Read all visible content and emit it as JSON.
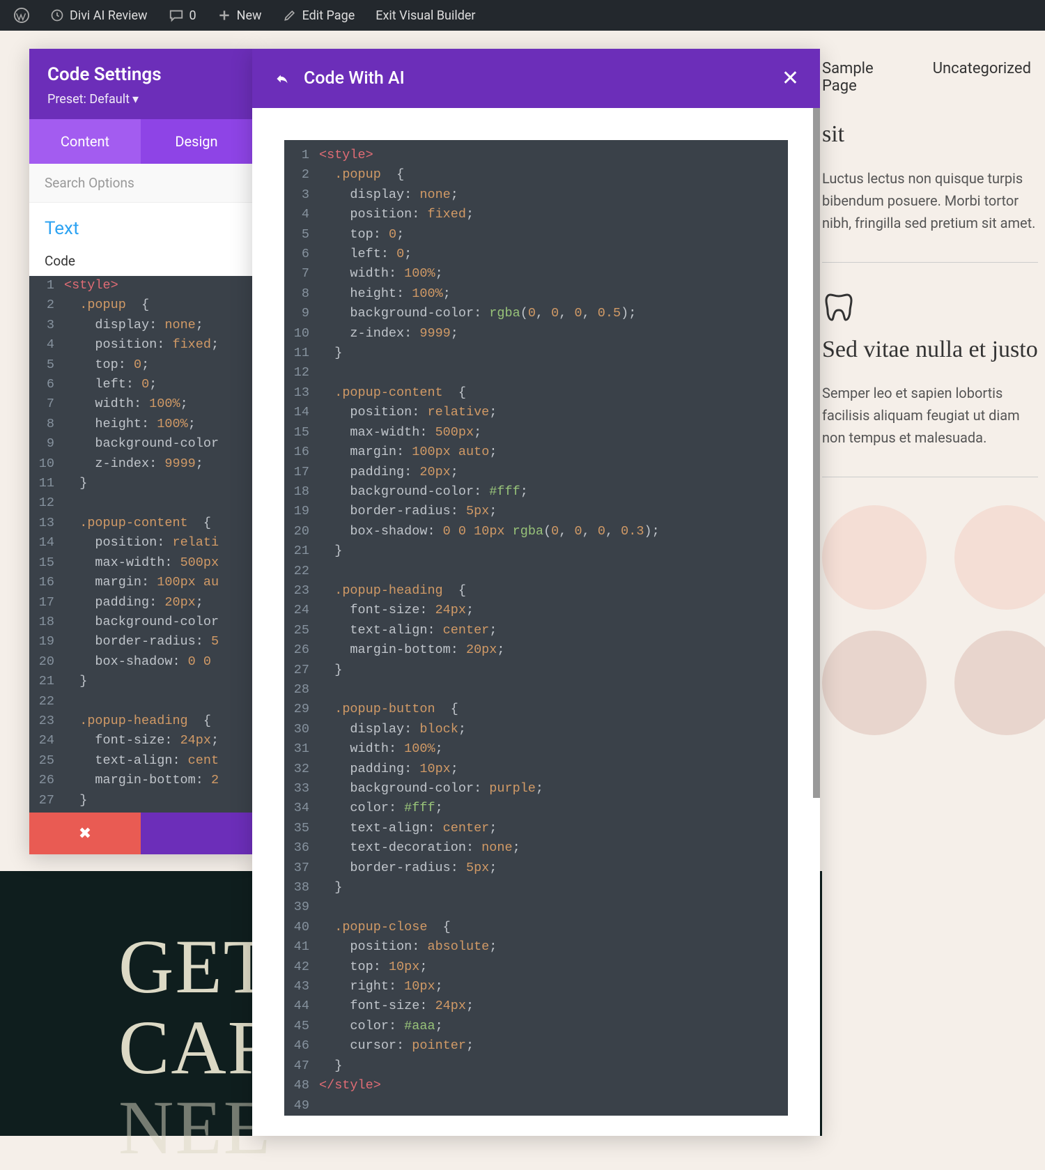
{
  "adminbar": {
    "site_title": "Divi AI Review",
    "comments_count": "0",
    "new_label": "New",
    "edit_page": "Edit Page",
    "exit_vb": "Exit Visual Builder"
  },
  "topnav": {
    "sample": "Sample Page",
    "uncat": "Uncategorized"
  },
  "rightcol": {
    "block1_trail": "sit",
    "block1_text": "Luctus lectus non quisque turpis bibendum posuere. Morbi tortor nibh, fringilla sed pretium sit amet.",
    "block2_heading": "Sed vitae nulla et justo",
    "block2_text": "Semper leo et sapien lobortis facilisis aliquam feugiat ut diam non tempus et malesuada."
  },
  "hero": {
    "line1": "GET",
    "line2": "CAR",
    "line3": "NEE"
  },
  "settings": {
    "title": "Code Settings",
    "preset": "Preset: Default",
    "tabs": {
      "content": "Content",
      "design": "Design"
    },
    "search_placeholder": "Search Options",
    "section_text": "Text",
    "field_code": "Code"
  },
  "ai": {
    "title": "Code With AI"
  },
  "code_lines_small": [
    {
      "n": "1",
      "html": "<span class='tag'>&lt;style&gt;</span>"
    },
    {
      "n": "2",
      "html": "  <span class='sel'>.popup</span>  <span class='punct'>{</span>"
    },
    {
      "n": "3",
      "html": "    <span class='prop'>display</span><span class='punct'>:</span> <span class='none'>none</span><span class='punct'>;</span>"
    },
    {
      "n": "4",
      "html": "    <span class='prop'>position</span><span class='punct'>:</span> <span class='none'>fixed</span><span class='punct'>;</span>"
    },
    {
      "n": "5",
      "html": "    <span class='prop'>top</span><span class='punct'>:</span> <span class='num'>0</span><span class='punct'>;</span>"
    },
    {
      "n": "6",
      "html": "    <span class='prop'>left</span><span class='punct'>:</span> <span class='num'>0</span><span class='punct'>;</span>"
    },
    {
      "n": "7",
      "html": "    <span class='prop'>width</span><span class='punct'>:</span> <span class='num'>100%</span><span class='punct'>;</span>"
    },
    {
      "n": "8",
      "html": "    <span class='prop'>height</span><span class='punct'>:</span> <span class='num'>100%</span><span class='punct'>;</span>"
    },
    {
      "n": "9",
      "html": "    <span class='prop'>background-color</span>"
    },
    {
      "n": "10",
      "html": "    <span class='prop'>z-index</span><span class='punct'>:</span> <span class='num'>9999</span><span class='punct'>;</span>"
    },
    {
      "n": "11",
      "html": "  <span class='punct'>}</span>"
    },
    {
      "n": "12",
      "html": ""
    },
    {
      "n": "13",
      "html": "  <span class='sel'>.popup-content</span>  <span class='punct'>{</span>"
    },
    {
      "n": "14",
      "html": "    <span class='prop'>position</span><span class='punct'>:</span> <span class='none'>relati</span>"
    },
    {
      "n": "15",
      "html": "    <span class='prop'>max-width</span><span class='punct'>:</span> <span class='num'>500px</span>"
    },
    {
      "n": "16",
      "html": "    <span class='prop'>margin</span><span class='punct'>:</span> <span class='num'>100px</span> <span class='none'>au</span>"
    },
    {
      "n": "17",
      "html": "    <span class='prop'>padding</span><span class='punct'>:</span> <span class='num'>20px</span><span class='punct'>;</span>"
    },
    {
      "n": "18",
      "html": "    <span class='prop'>background-color</span>"
    },
    {
      "n": "19",
      "html": "    <span class='prop'>border-radius</span><span class='punct'>:</span> <span class='num'>5</span>"
    },
    {
      "n": "20",
      "html": "    <span class='prop'>box-shadow</span><span class='punct'>:</span> <span class='num'>0</span> <span class='num'>0</span>"
    },
    {
      "n": "21",
      "html": "  <span class='punct'>}</span>"
    },
    {
      "n": "22",
      "html": ""
    },
    {
      "n": "23",
      "html": "  <span class='sel'>.popup-heading</span>  <span class='punct'>{</span>"
    },
    {
      "n": "24",
      "html": "    <span class='prop'>font-size</span><span class='punct'>:</span> <span class='num'>24px</span><span class='punct'>;</span>"
    },
    {
      "n": "25",
      "html": "    <span class='prop'>text-align</span><span class='punct'>:</span> <span class='none'>cent</span>"
    },
    {
      "n": "26",
      "html": "    <span class='prop'>margin-bottom</span><span class='punct'>:</span> <span class='num'>2</span>"
    },
    {
      "n": "27",
      "html": "  <span class='punct'>}</span>"
    }
  ],
  "code_lines_ai": [
    {
      "n": "1",
      "html": "<span class='tag'>&lt;style&gt;</span>"
    },
    {
      "n": "2",
      "html": "  <span class='sel'>.popup</span>  <span class='punct'>{</span>"
    },
    {
      "n": "3",
      "html": "    <span class='prop'>display</span><span class='punct'>:</span> <span class='none'>none</span><span class='punct'>;</span>"
    },
    {
      "n": "4",
      "html": "    <span class='prop'>position</span><span class='punct'>:</span> <span class='none'>fixed</span><span class='punct'>;</span>"
    },
    {
      "n": "5",
      "html": "    <span class='prop'>top</span><span class='punct'>:</span> <span class='num'>0</span><span class='punct'>;</span>"
    },
    {
      "n": "6",
      "html": "    <span class='prop'>left</span><span class='punct'>:</span> <span class='num'>0</span><span class='punct'>;</span>"
    },
    {
      "n": "7",
      "html": "    <span class='prop'>width</span><span class='punct'>:</span> <span class='num'>100%</span><span class='punct'>;</span>"
    },
    {
      "n": "8",
      "html": "    <span class='prop'>height</span><span class='punct'>:</span> <span class='num'>100%</span><span class='punct'>;</span>"
    },
    {
      "n": "9",
      "html": "    <span class='prop'>background-color</span><span class='punct'>:</span> <span class='fn'>rgba</span><span class='punct'>(</span><span class='num'>0</span><span class='punct'>,</span> <span class='num'>0</span><span class='punct'>,</span> <span class='num'>0</span><span class='punct'>,</span> <span class='num'>0.5</span><span class='punct'>);</span>"
    },
    {
      "n": "10",
      "html": "    <span class='prop'>z-index</span><span class='punct'>:</span> <span class='num'>9999</span><span class='punct'>;</span>"
    },
    {
      "n": "11",
      "html": "  <span class='punct'>}</span>"
    },
    {
      "n": "12",
      "html": ""
    },
    {
      "n": "13",
      "html": "  <span class='sel'>.popup-content</span>  <span class='punct'>{</span>"
    },
    {
      "n": "14",
      "html": "    <span class='prop'>position</span><span class='punct'>:</span> <span class='none'>relative</span><span class='punct'>;</span>"
    },
    {
      "n": "15",
      "html": "    <span class='prop'>max-width</span><span class='punct'>:</span> <span class='num'>500px</span><span class='punct'>;</span>"
    },
    {
      "n": "16",
      "html": "    <span class='prop'>margin</span><span class='punct'>:</span> <span class='num'>100px</span> <span class='none'>auto</span><span class='punct'>;</span>"
    },
    {
      "n": "17",
      "html": "    <span class='prop'>padding</span><span class='punct'>:</span> <span class='num'>20px</span><span class='punct'>;</span>"
    },
    {
      "n": "18",
      "html": "    <span class='prop'>background-color</span><span class='punct'>:</span> <span class='hex'>#fff</span><span class='punct'>;</span>"
    },
    {
      "n": "19",
      "html": "    <span class='prop'>border-radius</span><span class='punct'>:</span> <span class='num'>5px</span><span class='punct'>;</span>"
    },
    {
      "n": "20",
      "html": "    <span class='prop'>box-shadow</span><span class='punct'>:</span> <span class='num'>0</span> <span class='num'>0</span> <span class='num'>10px</span> <span class='fn'>rgba</span><span class='punct'>(</span><span class='num'>0</span><span class='punct'>,</span> <span class='num'>0</span><span class='punct'>,</span> <span class='num'>0</span><span class='punct'>,</span> <span class='num'>0.3</span><span class='punct'>);</span>"
    },
    {
      "n": "21",
      "html": "  <span class='punct'>}</span>"
    },
    {
      "n": "22",
      "html": ""
    },
    {
      "n": "23",
      "html": "  <span class='sel'>.popup-heading</span>  <span class='punct'>{</span>"
    },
    {
      "n": "24",
      "html": "    <span class='prop'>font-size</span><span class='punct'>:</span> <span class='num'>24px</span><span class='punct'>;</span>"
    },
    {
      "n": "25",
      "html": "    <span class='prop'>text-align</span><span class='punct'>:</span> <span class='none'>center</span><span class='punct'>;</span>"
    },
    {
      "n": "26",
      "html": "    <span class='prop'>margin-bottom</span><span class='punct'>:</span> <span class='num'>20px</span><span class='punct'>;</span>"
    },
    {
      "n": "27",
      "html": "  <span class='punct'>}</span>"
    },
    {
      "n": "28",
      "html": ""
    },
    {
      "n": "29",
      "html": "  <span class='sel'>.popup-button</span>  <span class='punct'>{</span>"
    },
    {
      "n": "30",
      "html": "    <span class='prop'>display</span><span class='punct'>:</span> <span class='none'>block</span><span class='punct'>;</span>"
    },
    {
      "n": "31",
      "html": "    <span class='prop'>width</span><span class='punct'>:</span> <span class='num'>100%</span><span class='punct'>;</span>"
    },
    {
      "n": "32",
      "html": "    <span class='prop'>padding</span><span class='punct'>:</span> <span class='num'>10px</span><span class='punct'>;</span>"
    },
    {
      "n": "33",
      "html": "    <span class='prop'>background-color</span><span class='punct'>:</span> <span class='none'>purple</span><span class='punct'>;</span>"
    },
    {
      "n": "34",
      "html": "    <span class='prop'>color</span><span class='punct'>:</span> <span class='hex'>#fff</span><span class='punct'>;</span>"
    },
    {
      "n": "35",
      "html": "    <span class='prop'>text-align</span><span class='punct'>:</span> <span class='none'>center</span><span class='punct'>;</span>"
    },
    {
      "n": "36",
      "html": "    <span class='prop'>text-decoration</span><span class='punct'>:</span> <span class='none'>none</span><span class='punct'>;</span>"
    },
    {
      "n": "37",
      "html": "    <span class='prop'>border-radius</span><span class='punct'>:</span> <span class='num'>5px</span><span class='punct'>;</span>"
    },
    {
      "n": "38",
      "html": "  <span class='punct'>}</span>"
    },
    {
      "n": "39",
      "html": ""
    },
    {
      "n": "40",
      "html": "  <span class='sel'>.popup-close</span>  <span class='punct'>{</span>"
    },
    {
      "n": "41",
      "html": "    <span class='prop'>position</span><span class='punct'>:</span> <span class='none'>absolute</span><span class='punct'>;</span>"
    },
    {
      "n": "42",
      "html": "    <span class='prop'>top</span><span class='punct'>:</span> <span class='num'>10px</span><span class='punct'>;</span>"
    },
    {
      "n": "43",
      "html": "    <span class='prop'>right</span><span class='punct'>:</span> <span class='num'>10px</span><span class='punct'>;</span>"
    },
    {
      "n": "44",
      "html": "    <span class='prop'>font-size</span><span class='punct'>:</span> <span class='num'>24px</span><span class='punct'>;</span>"
    },
    {
      "n": "45",
      "html": "    <span class='prop'>color</span><span class='punct'>:</span> <span class='hex'>#aaa</span><span class='punct'>;</span>"
    },
    {
      "n": "46",
      "html": "    <span class='prop'>cursor</span><span class='punct'>:</span> <span class='none'>pointer</span><span class='punct'>;</span>"
    },
    {
      "n": "47",
      "html": "  <span class='punct'>}</span>"
    },
    {
      "n": "48",
      "html": "<span class='tag'>&lt;/style&gt;</span>"
    },
    {
      "n": "49",
      "html": ""
    }
  ]
}
